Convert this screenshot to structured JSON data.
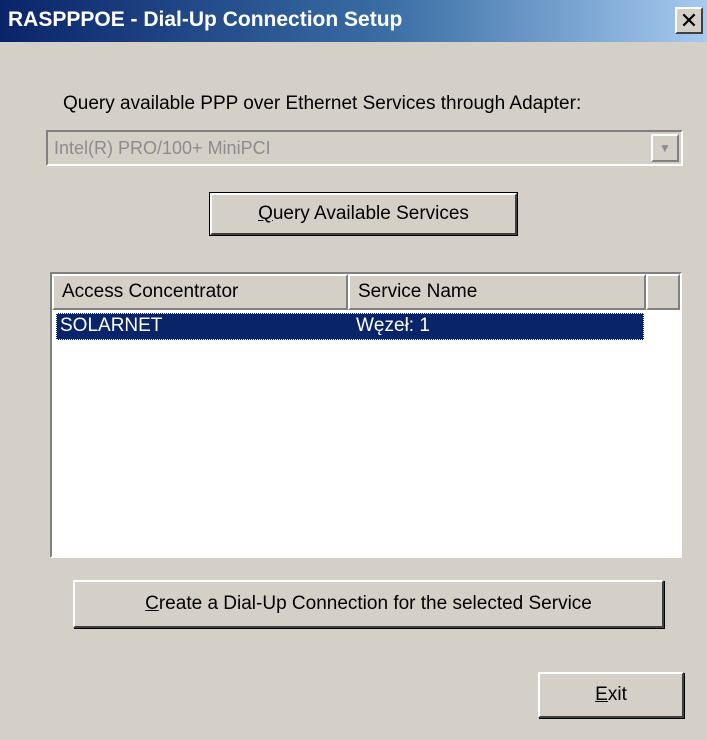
{
  "window": {
    "title": "RASPPPOE - Dial-Up Connection Setup",
    "close_symbol": "✕"
  },
  "query_label": "Query available PPP over Ethernet Services through Adapter:",
  "adapter_combo": {
    "value": "Intel(R) PRO/100+ MiniPCI",
    "arrow": "▼"
  },
  "buttons": {
    "query_hotkey": "Q",
    "query_rest": "uery Available Services",
    "create_hotkey": "C",
    "create_rest": "reate a Dial-Up Connection for the selected Service",
    "exit_hotkey": "E",
    "exit_rest": "xit"
  },
  "services_list": {
    "columns": [
      "Access Concentrator",
      "Service Name",
      ""
    ],
    "rows": [
      {
        "access_concentrator": "SOLARNET",
        "service_name": "Węzeł: 1",
        "selected": true
      }
    ]
  },
  "colors": {
    "title_bar": "#0a246a",
    "selection": "#0a246a",
    "face": "#d4d0c8"
  }
}
